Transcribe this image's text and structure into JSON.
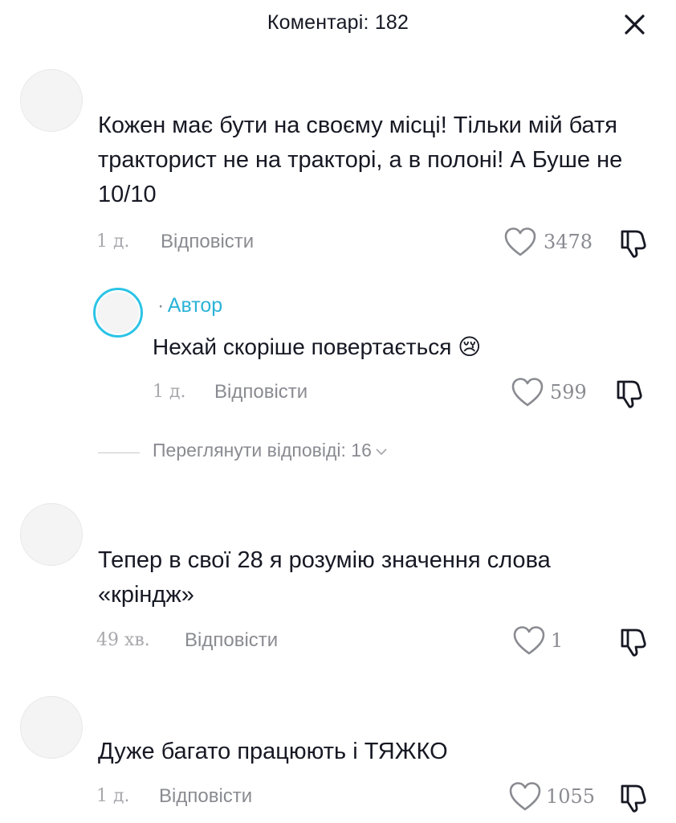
{
  "header": {
    "title": "Коментарі: 182",
    "close_icon": "close-icon"
  },
  "comments": [
    {
      "text": "Кожен має бути на своєму місці! Тільки мій батя тракторист не на тракторі, а в полоні! А Буше не 10/10",
      "time": "1 д.",
      "reply_label": "Відповісти",
      "likes": "3478"
    },
    {
      "text": "Тепер в свої 28 я розумію значення слова «кріндж»",
      "time": "49 хв.",
      "reply_label": "Відповісти",
      "likes": "1"
    },
    {
      "text": "Дуже багато працюють і ТЯЖКО",
      "time": "1 д.",
      "reply_label": "Відповісти",
      "likes": "1055"
    }
  ],
  "reply": {
    "author_dot": "·",
    "author_label": "Автор",
    "text": "Нехай скоріше повертається",
    "emoji": "😢",
    "time": "1 д.",
    "reply_label": "Відповісти",
    "likes": "599"
  },
  "view_replies": {
    "label": "Переглянути відповіді: ",
    "count": "16"
  },
  "colors": {
    "author_accent": "#2bb3d7",
    "text_primary": "#161823",
    "text_secondary": "#8a8b91"
  }
}
